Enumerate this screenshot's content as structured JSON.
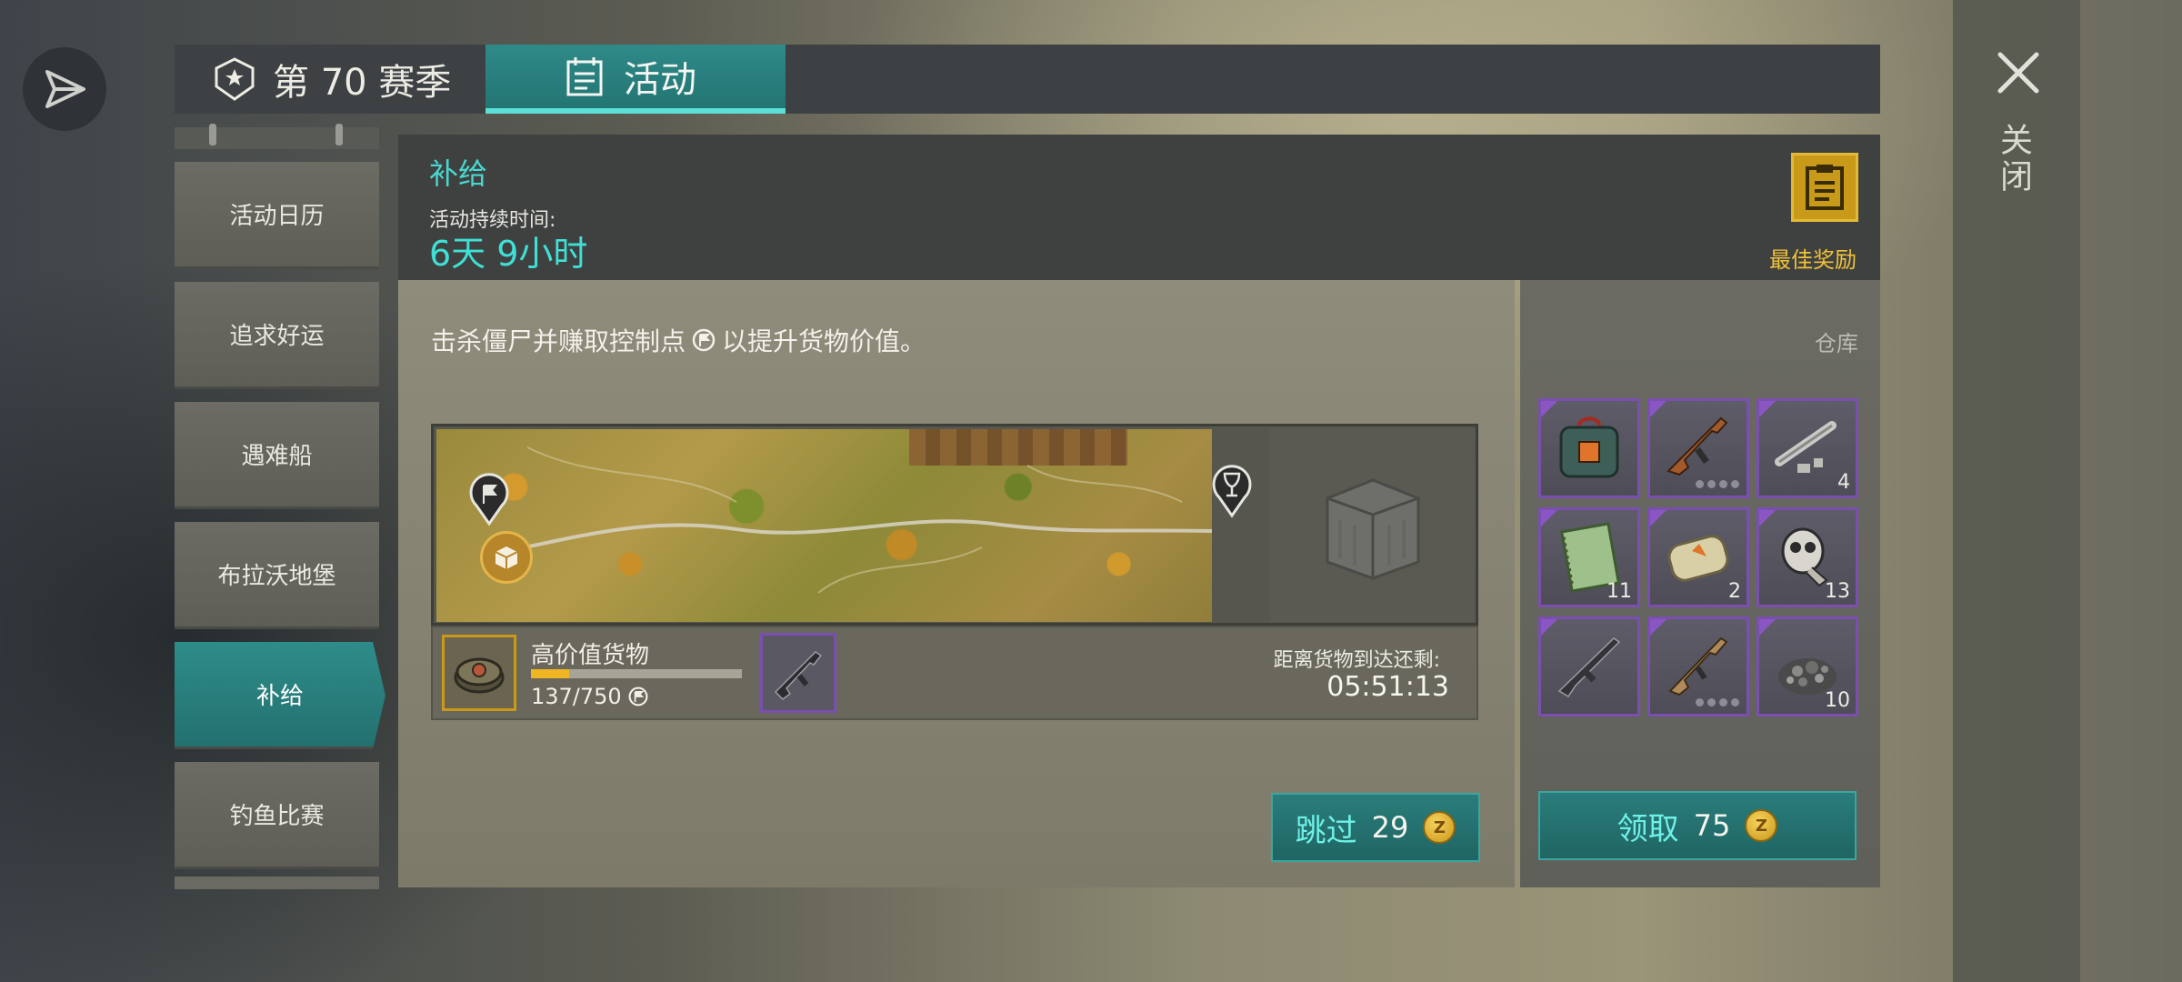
{
  "topbar": {
    "season_label": "第 70 赛季",
    "activity_label": "活动"
  },
  "close": {
    "label": "关闭"
  },
  "sidebar": {
    "items": [
      {
        "label": "活动日历"
      },
      {
        "label": "追求好运"
      },
      {
        "label": "遇难船"
      },
      {
        "label": "布拉沃地堡"
      },
      {
        "label": "补给",
        "active": true
      },
      {
        "label": "钓鱼比赛"
      }
    ]
  },
  "header": {
    "title": "补给",
    "duration_label": "活动持续时间:",
    "duration_value": "6天 9小时",
    "best_reward_label": "最佳奖励"
  },
  "content": {
    "description": "击杀僵尸并赚取控制点",
    "description_tail": "以提升货物价值。",
    "cargo_name": "高价值货物",
    "cargo_progress": "137/750",
    "cargo_progress_fraction": 0.183,
    "arrive_label": "距离货物到达还剩:",
    "arrive_time": "05:51:13",
    "skip_label": "跳过",
    "skip_cost": "29"
  },
  "warehouse": {
    "label": "仓库",
    "slots": [
      {
        "icon": "supply-bag-icon",
        "count": ""
      },
      {
        "icon": "assault-rifle-icon",
        "count": "",
        "dots": true
      },
      {
        "icon": "pipe-parts-icon",
        "count": "4"
      },
      {
        "icon": "notebook-icon",
        "count": "11"
      },
      {
        "icon": "soap-bar-icon",
        "count": "2"
      },
      {
        "icon": "skull-mask-icon",
        "count": "13"
      },
      {
        "icon": "shotgun-icon",
        "count": ""
      },
      {
        "icon": "tan-rifle-icon",
        "count": "",
        "dots": true
      },
      {
        "icon": "scrap-pile-icon",
        "count": "10"
      }
    ],
    "claim_label": "领取",
    "claim_cost": "75"
  },
  "colors": {
    "accent_teal": "#2e8c89",
    "accent_cyan_text": "#48d8cf",
    "gold": "#c99a1a",
    "purple_rarity": "#7b4fb0"
  }
}
